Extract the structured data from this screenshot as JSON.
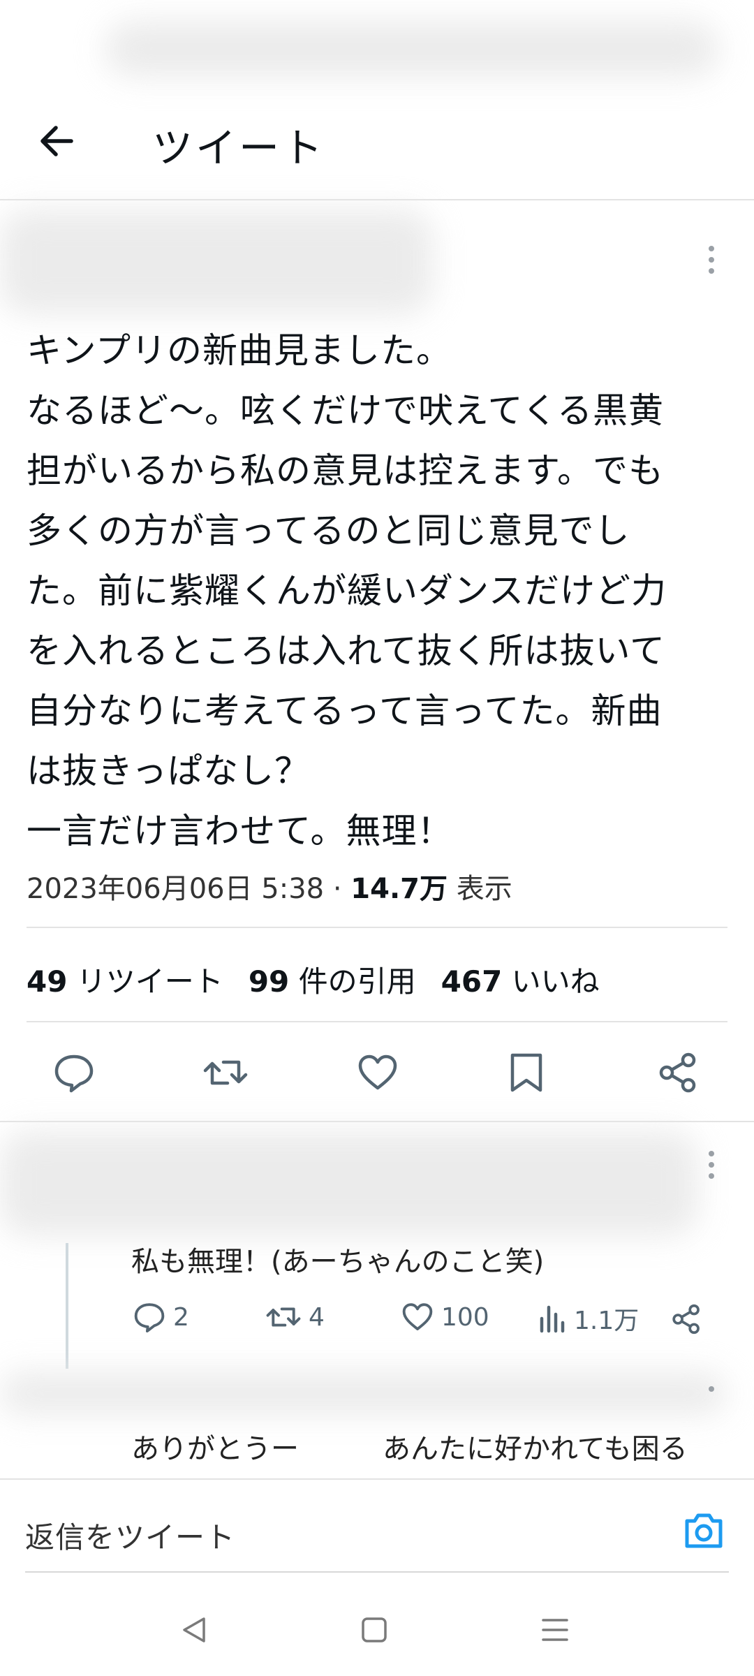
{
  "header": {
    "title": "ツイート"
  },
  "tweet": {
    "text": "キンプリの新曲見ました。\nなるほど〜。呟くだけで吠えてくる黒黄\n担がいるから私の意見は控えます。でも\n多くの方が言ってるのと同じ意見でし\nた。前に紫耀くんが緩いダンスだけど力\nを入れるところは入れて抜く所は抜いて\n自分なりに考えてるって言ってた。新曲\nは抜きっぱなし？\n一言だけ言わせて。無理！",
    "datetime": "2023年06月06日 5:38 · ",
    "views_count": "14.7万",
    "views_label": " 表示",
    "retweets_count": "49",
    "retweets_label": " リツイート",
    "quotes_count": "99",
    "quotes_label": " 件の引用",
    "likes_count": "467",
    "likes_label": " いいね"
  },
  "replies": [
    {
      "text": "私も無理！(あーちゃんのこと笑)",
      "reply_count": "2",
      "retweet_count": "4",
      "like_count": "100",
      "views_count": "1.1万"
    },
    {
      "text": "ありがとうー",
      "text2": "あんたに好かれても困る"
    }
  ],
  "composer": {
    "placeholder": "返信をツイート"
  },
  "colors": {
    "accent": "#1d9bf0",
    "text": "#0f1419",
    "secondary": "#536471",
    "divider": "#e3e3e3"
  },
  "icons": {
    "back": "arrow-left-icon",
    "more": "more-vertical-icon",
    "reply": "speech-bubble-icon",
    "retweet": "retweet-icon",
    "like": "heart-icon",
    "bookmark": "bookmark-icon",
    "share": "share-icon",
    "views": "bar-chart-icon",
    "camera": "camera-icon",
    "nav_back": "triangle-back-icon",
    "nav_home": "square-home-icon",
    "nav_menu": "menu-lines-icon"
  }
}
